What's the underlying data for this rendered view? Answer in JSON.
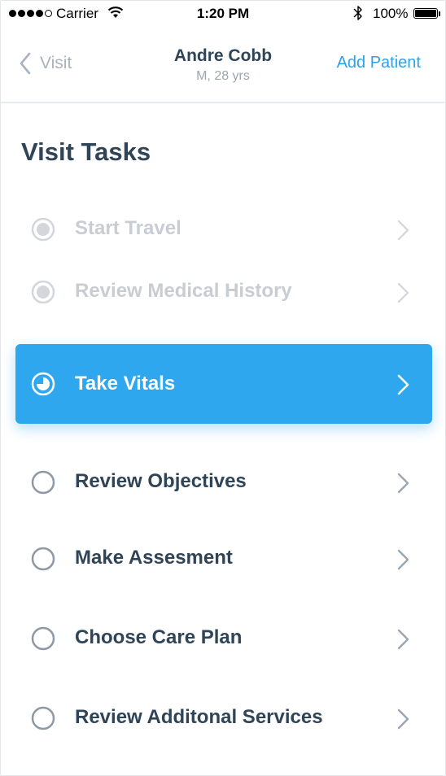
{
  "status_bar": {
    "carrier": "Carrier",
    "time": "1:20 PM",
    "battery": "100%"
  },
  "nav": {
    "back_label": "Visit",
    "patient_name": "Andre Cobb",
    "patient_info": "M, 28 yrs",
    "action_label": "Add Patient"
  },
  "page_title": "Visit Tasks",
  "tasks": [
    {
      "label": "Start Travel",
      "state": "completed"
    },
    {
      "label": "Review Medical History",
      "state": "completed"
    },
    {
      "label": "Take Vitals",
      "state": "in-progress"
    },
    {
      "label": "Review Objectives",
      "state": "pending"
    },
    {
      "label": "Make Assesment",
      "state": "pending"
    },
    {
      "label": "Choose Care Plan",
      "state": "pending"
    },
    {
      "label": "Review Additonal Services",
      "state": "pending"
    }
  ],
  "colors": {
    "accent": "#2ea7ee",
    "link": "#2aa3ec",
    "text": "#2f4456",
    "muted": "#c8cdd3"
  }
}
